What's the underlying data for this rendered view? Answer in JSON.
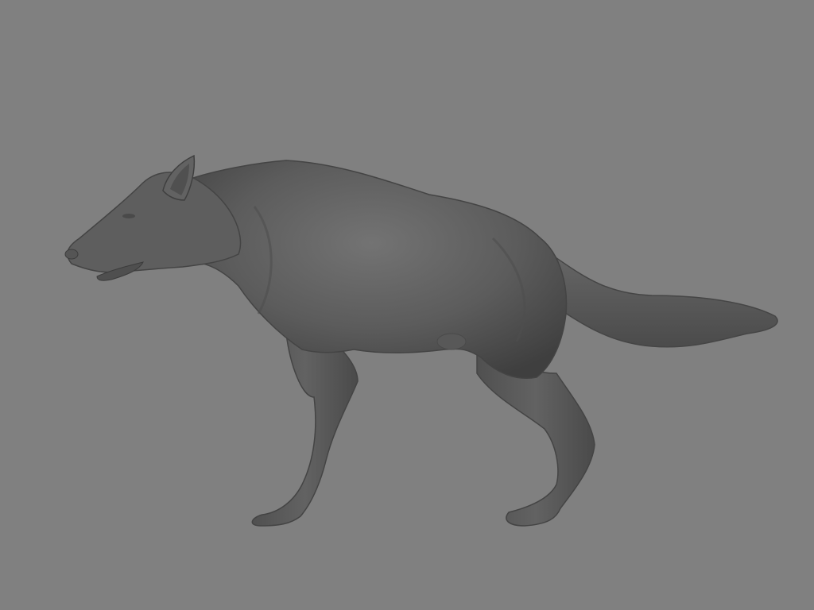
{
  "viewport": {
    "background_color": "#808080",
    "model": {
      "subject": "wolf",
      "render_style": "matcap-gray-sculpt",
      "base_color": "#5f5f5f",
      "shadow_color": "#3e3e3e",
      "highlight_color": "#7a7a7a"
    }
  }
}
